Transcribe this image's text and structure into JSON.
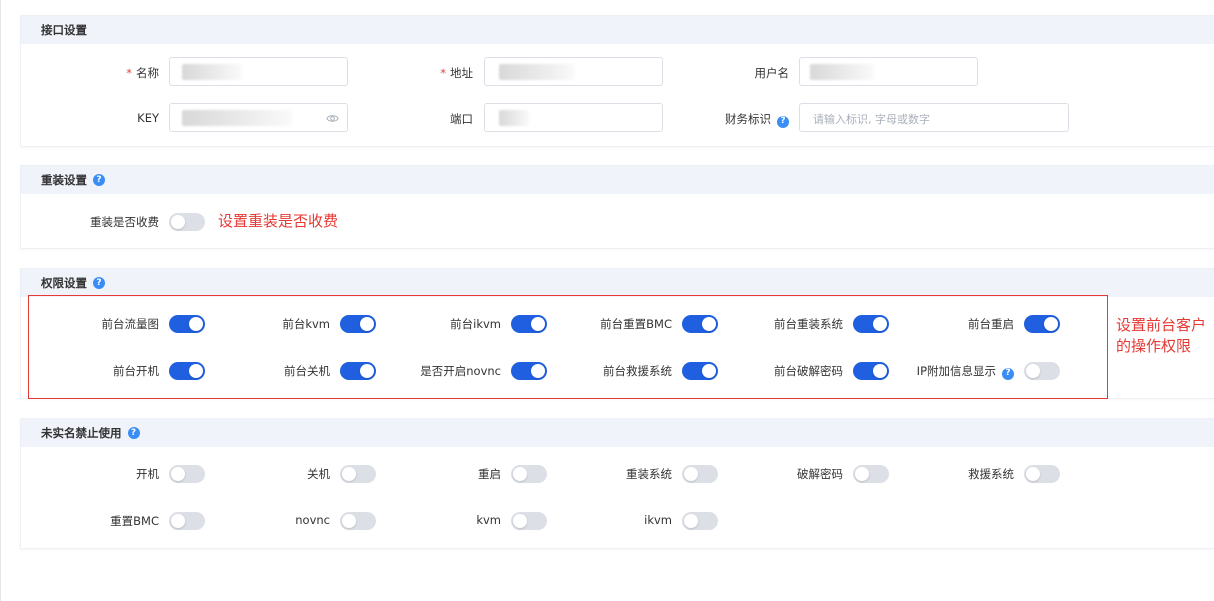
{
  "interface": {
    "title": "接口设置",
    "name_label": "名称",
    "address_label": "地址",
    "username_label": "用户名",
    "key_label": "KEY",
    "port_label": "端口",
    "finance_label": "财务标识",
    "finance_placeholder": "请输入标识, 字母或数字"
  },
  "reinstall": {
    "title": "重装设置",
    "charge_label": "重装是否收费",
    "charge_on": false,
    "annotation": "设置重装是否收费"
  },
  "permissions": {
    "title": "权限设置",
    "annotation": "设置前台客户的操作权限",
    "items": [
      {
        "label": "前台流量图",
        "on": true
      },
      {
        "label": "前台kvm",
        "on": true
      },
      {
        "label": "前台ikvm",
        "on": true
      },
      {
        "label": "前台重置BMC",
        "on": true
      },
      {
        "label": "前台重装系统",
        "on": true
      },
      {
        "label": "前台重启",
        "on": true
      },
      {
        "label": "前台开机",
        "on": true
      },
      {
        "label": "前台关机",
        "on": true
      },
      {
        "label": "是否开启novnc",
        "on": true
      },
      {
        "label": "前台救援系统",
        "on": true
      },
      {
        "label": "前台破解密码",
        "on": true
      },
      {
        "label": "IP附加信息显示",
        "on": false
      }
    ]
  },
  "unverified": {
    "title": "未实名禁止使用",
    "items": [
      {
        "label": "开机",
        "on": false
      },
      {
        "label": "关机",
        "on": false
      },
      {
        "label": "重启",
        "on": false
      },
      {
        "label": "重装系统",
        "on": false
      },
      {
        "label": "破解密码",
        "on": false
      },
      {
        "label": "救援系统",
        "on": false
      },
      {
        "label": "重置BMC",
        "on": false
      },
      {
        "label": "novnc",
        "on": false
      },
      {
        "label": "kvm",
        "on": false
      },
      {
        "label": "ikvm",
        "on": false
      }
    ]
  },
  "colors": {
    "switch_on": "#1f5fe0",
    "switch_off": "#dcdfe6",
    "annotation": "#e53935",
    "help": "#3a8df5"
  }
}
